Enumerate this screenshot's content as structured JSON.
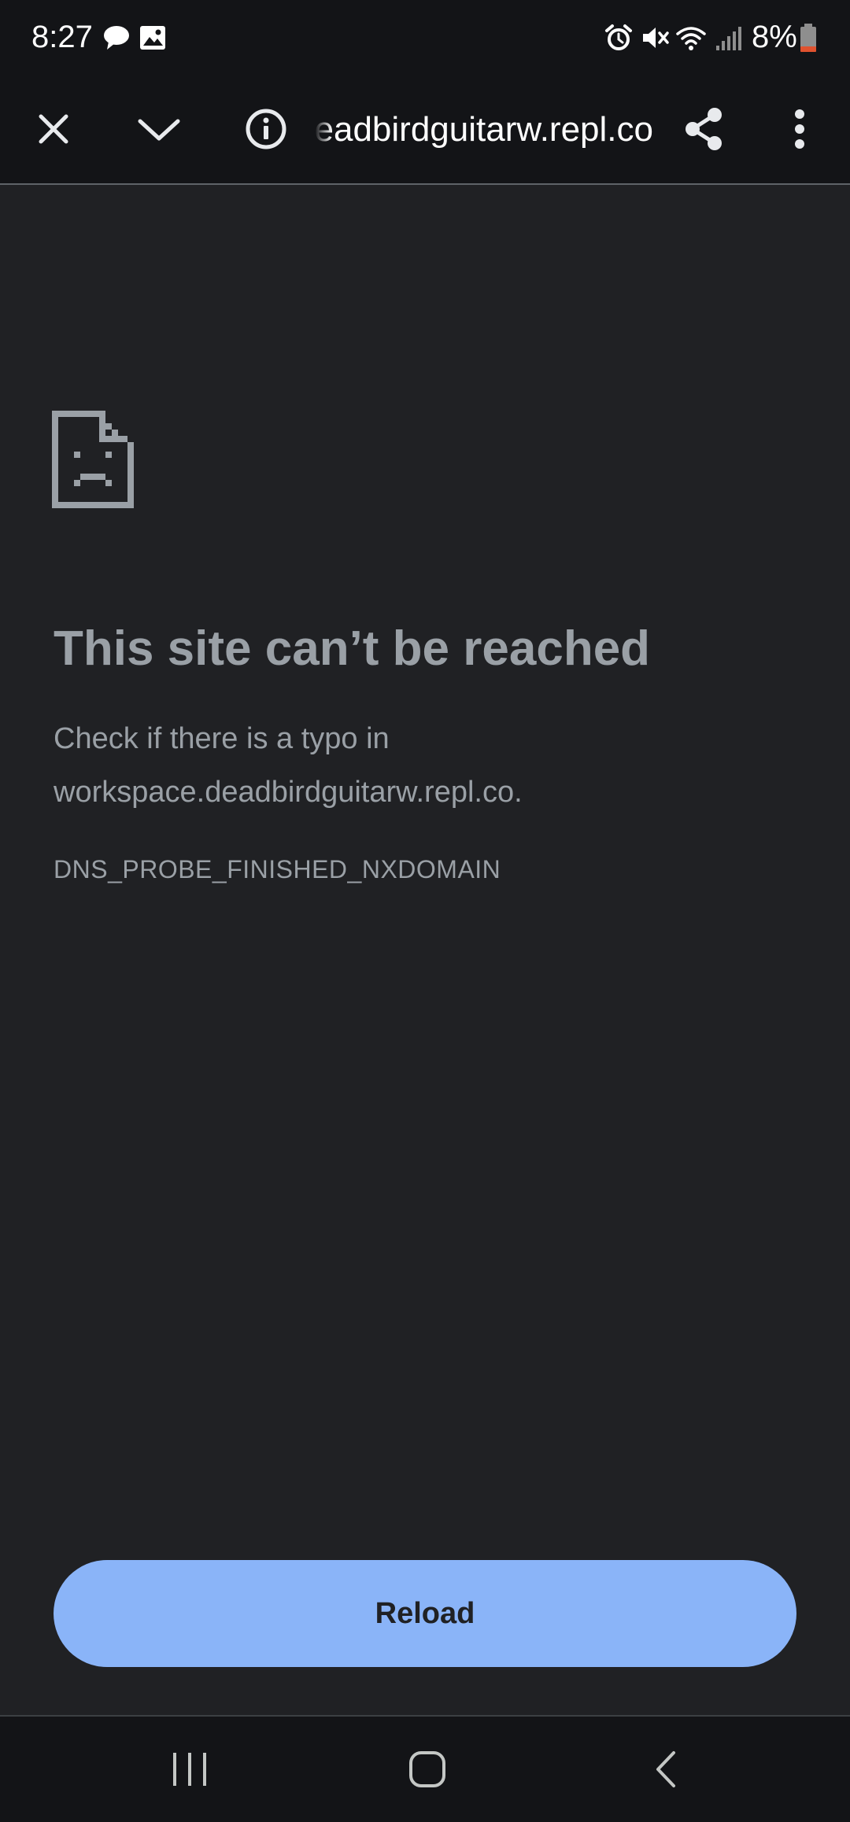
{
  "status_bar": {
    "time": "8:27",
    "battery_text": "8%",
    "icons_left": [
      "chat-bubble-icon",
      "image-icon"
    ],
    "icons_right": [
      "alarm-icon",
      "mute-icon",
      "wifi-icon",
      "signal-icon",
      "battery-icon"
    ]
  },
  "toolbar": {
    "url": "workspace.deadbirdguitarw.repl.co",
    "icons": [
      "close-icon",
      "chevron-down-icon",
      "info-icon",
      "share-icon",
      "more-vert-icon"
    ]
  },
  "error_page": {
    "icon": "sad-document-icon",
    "title": "This site can’t be reached",
    "description_line1": "Check if there is a typo in",
    "description_line2": "workspace.deadbirdguitarw.repl.co.",
    "error_code": "DNS_PROBE_FINISHED_NXDOMAIN",
    "reload_label": "Reload"
  },
  "nav_bar": {
    "icons": [
      "recents-icon",
      "home-icon",
      "back-icon"
    ]
  },
  "colors": {
    "background": "#202124",
    "bars": "#131417",
    "accent": "#8ab4f8",
    "muted_text": "#9aa0a6",
    "battery_low": "#e0522f"
  }
}
